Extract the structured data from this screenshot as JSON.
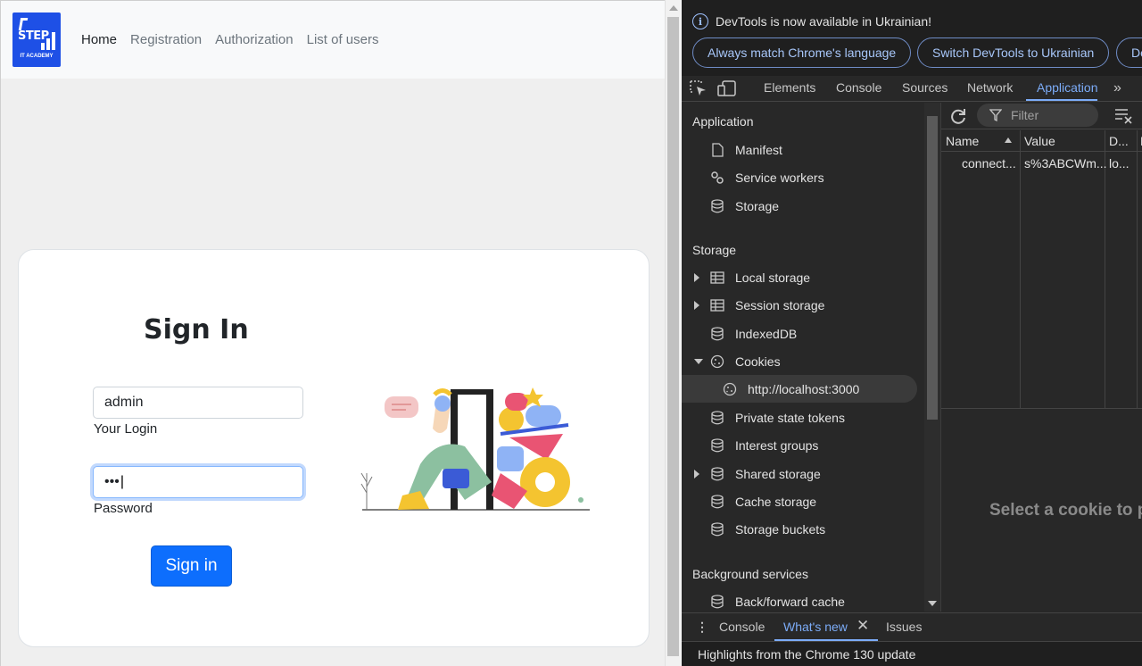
{
  "app": {
    "nav": {
      "logo_text": "STEP",
      "logo_sub": "IT ACADEMY",
      "links": [
        "Home",
        "Registration",
        "Authorization",
        "List of users"
      ]
    },
    "form": {
      "title": "Sign In",
      "login_value": "admin",
      "login_label": "Your Login",
      "password_value": "•••",
      "password_label": "Password",
      "submit_label": "Sign in"
    }
  },
  "devtools": {
    "infobar": {
      "message": "DevTools is now available in Ukrainian!",
      "btn_match": "Always match Chrome's language",
      "btn_switch": "Switch DevTools to Ukrainian",
      "btn_more": "Don't show again"
    },
    "tabs": [
      "Elements",
      "Console",
      "Sources",
      "Network",
      "Application"
    ],
    "active_tab": "Application",
    "sidebar": {
      "section_application": "Application",
      "app_items": [
        "Manifest",
        "Service workers",
        "Storage"
      ],
      "section_storage": "Storage",
      "storage_items": [
        "Local storage",
        "Session storage",
        "IndexedDB",
        "Cookies",
        "http://localhost:3000",
        "Private state tokens",
        "Interest groups",
        "Shared storage",
        "Cache storage",
        "Storage buckets"
      ],
      "section_background": "Background services",
      "background_items": [
        "Back/forward cache"
      ]
    },
    "cookies": {
      "filter_placeholder": "Filter",
      "columns": [
        "Name",
        "Value",
        "D...",
        "E"
      ],
      "row": [
        "connect...",
        "s%3ABCWm...",
        "lo...",
        ""
      ],
      "empty_message": "Select a cookie to preview its value"
    },
    "drawer": {
      "tabs": [
        "Console",
        "What's new",
        "Issues"
      ],
      "active": "What's new",
      "content": "Highlights from the Chrome 130 update"
    }
  }
}
